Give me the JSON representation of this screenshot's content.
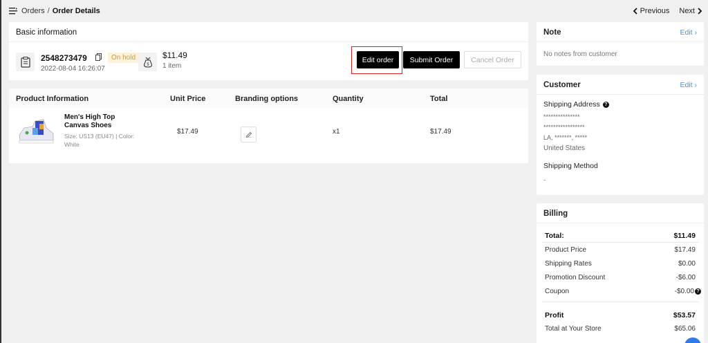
{
  "breadcrumb": {
    "parent": "Orders",
    "separator": "/",
    "current": "Order Details"
  },
  "pager": {
    "previous": "Previous",
    "next": "Next"
  },
  "basic": {
    "title": "Basic information",
    "order_number": "2548273479",
    "status": "On hold",
    "date": "2022-08-04 16:26:07",
    "amount": "$11.49",
    "items": "1 item",
    "edit_label": "Edit order",
    "submit_label": "Submit Order",
    "cancel_label": "Cancel Order"
  },
  "products": {
    "columns": {
      "product": "Product Information",
      "unit_price": "Unit Price",
      "branding": "Branding options",
      "quantity": "Quantity",
      "total": "Total"
    },
    "rows": [
      {
        "name": "Men's High Top Canvas Shoes",
        "attrs": "Size: US13 (EU47) | Color: White",
        "unit_price": "$17.49",
        "quantity": "x1",
        "total": "$17.49"
      }
    ]
  },
  "note": {
    "title": "Note",
    "edit": "Edit",
    "text": "No notes from customer"
  },
  "customer": {
    "title": "Customer",
    "edit": "Edit",
    "shipping_address_label": "Shipping Address",
    "address_lines": [
      "***************",
      "*****************",
      "LA, *******, *****",
      "United States"
    ],
    "shipping_method_label": "Shipping Method",
    "shipping_method": "-"
  },
  "billing": {
    "title": "Billing",
    "total_label": "Total:",
    "total": "$11.49",
    "product_price_label": "Product Price",
    "product_price": "$17.49",
    "shipping_label": "Shipping Rates",
    "shipping": "$0.00",
    "promotion_label": "Promotion Discount",
    "promotion": "-$6.00",
    "coupon_label": "Coupon",
    "coupon": "-$0.00",
    "profit_label": "Profit",
    "profit": "$53.57",
    "store_total_label": "Total at Your Store",
    "store_total": "$65.06"
  },
  "colors": {
    "accent_link": "#4a8fe2",
    "status_bg": "#fdf3dc",
    "status_text": "#d29a2b",
    "highlight": "#e02020"
  }
}
